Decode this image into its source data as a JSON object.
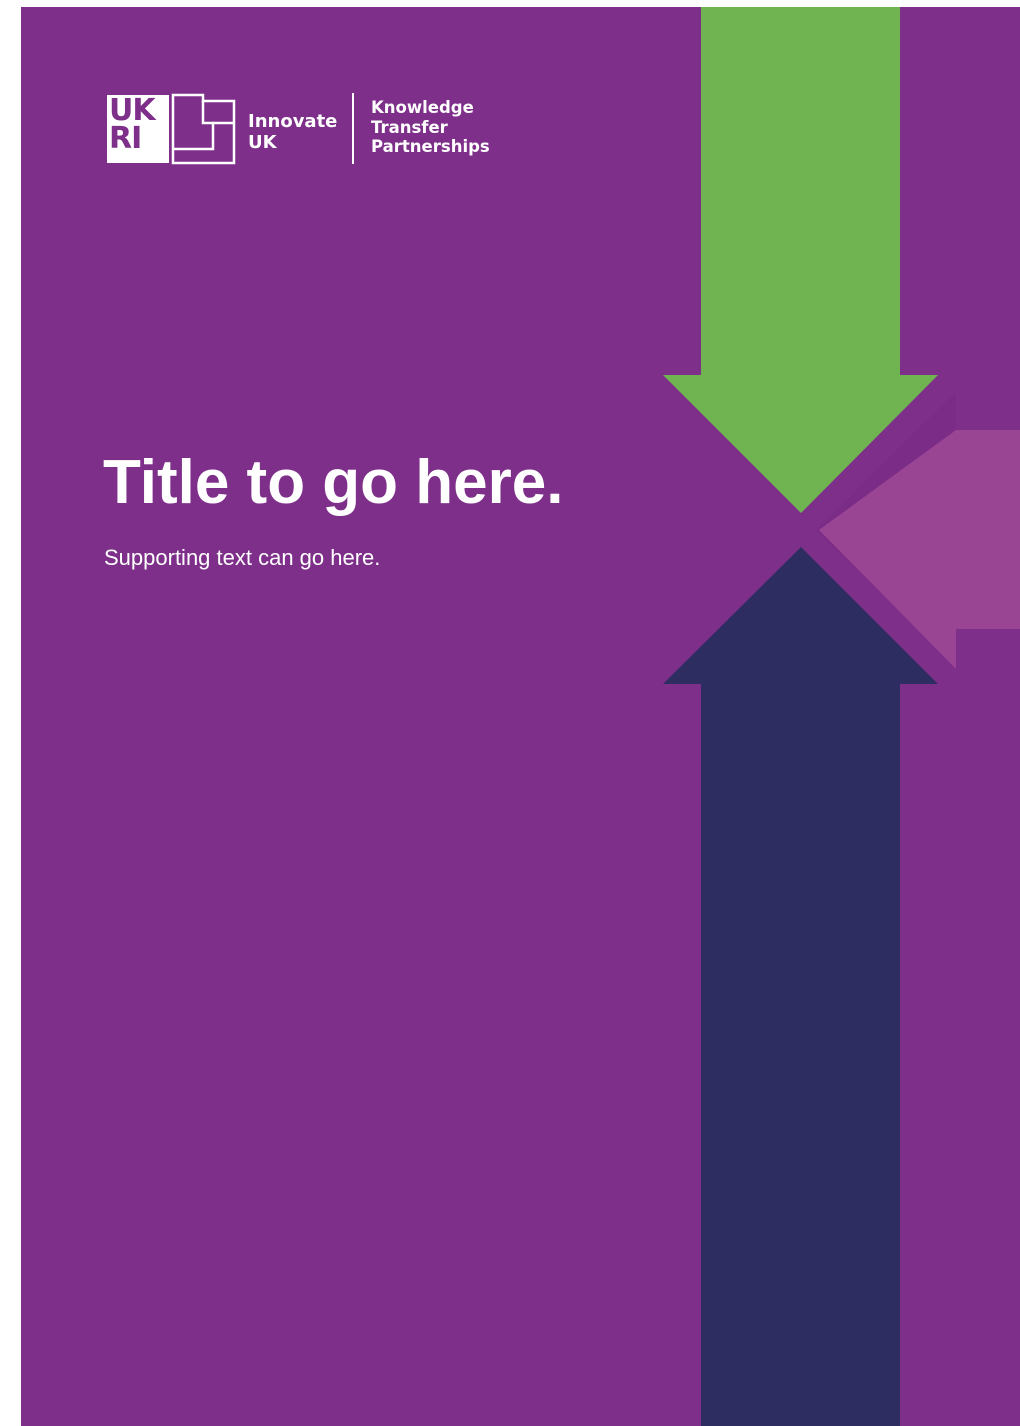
{
  "logo": {
    "ukri_line1": "UK",
    "ukri_line2": "RI",
    "innovate_line1": "Innovate",
    "innovate_line2": "UK",
    "ktp_line1": "Knowledge",
    "ktp_line2": "Transfer",
    "ktp_line3": "Partnerships"
  },
  "cover": {
    "title": "Title to go here.",
    "subtitle": "Supporting text can go here."
  },
  "colors": {
    "background": "#7e2f8a",
    "arrow_down": "#6fb450",
    "arrow_left": "#9a4594",
    "arrow_up": "#2e2d62",
    "text": "#ffffff"
  }
}
